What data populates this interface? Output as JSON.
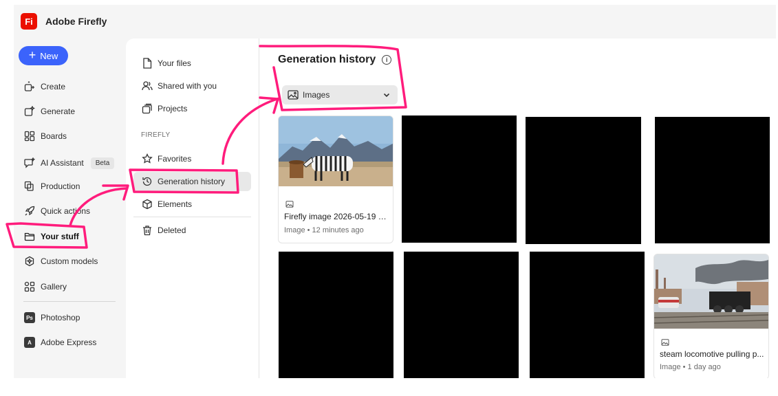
{
  "app": {
    "logo": "Fi",
    "name": "Adobe Firefly"
  },
  "rail": {
    "new_label": "New",
    "items": [
      {
        "label": "Create",
        "icon": "create-icon"
      },
      {
        "label": "Generate",
        "icon": "generate-icon"
      },
      {
        "label": "Boards",
        "icon": "boards-icon"
      },
      {
        "label": "AI Assistant",
        "icon": "ai-assistant-icon",
        "badge": "Beta"
      },
      {
        "label": "Production",
        "icon": "production-icon"
      },
      {
        "label": "Quick actions",
        "icon": "rocket-icon"
      },
      {
        "label": "Your stuff",
        "icon": "folder-icon",
        "active": true
      },
      {
        "label": "Custom models",
        "icon": "custom-models-icon"
      },
      {
        "label": "Gallery",
        "icon": "gallery-icon"
      }
    ],
    "apps": [
      {
        "label": "Photoshop",
        "icon_text": "Ps"
      },
      {
        "label": "Adobe Express",
        "icon_text": "A"
      }
    ]
  },
  "subnav": {
    "items_top": [
      {
        "label": "Your files",
        "icon": "file-icon"
      },
      {
        "label": "Shared with you",
        "icon": "shared-icon"
      },
      {
        "label": "Projects",
        "icon": "projects-icon"
      }
    ],
    "section": "FIREFLY",
    "items_firefly": [
      {
        "label": "Favorites",
        "icon": "star-icon"
      },
      {
        "label": "Generation history",
        "icon": "history-icon",
        "active": true
      },
      {
        "label": "Elements",
        "icon": "cube-icon"
      }
    ],
    "deleted": "Deleted"
  },
  "content": {
    "title": "Generation history",
    "info": "i",
    "filter": "Images",
    "cards": [
      {
        "name": "Firefly image 2026-05-19 21...",
        "meta": "Image • 12 minutes ago"
      },
      {
        "name": "steam locomotive pulling p...",
        "meta": "Image • 1 day ago"
      }
    ]
  },
  "colors": {
    "accent": "#3b63fb",
    "brand": "#eb1000",
    "annotation": "#ff1c7c"
  }
}
